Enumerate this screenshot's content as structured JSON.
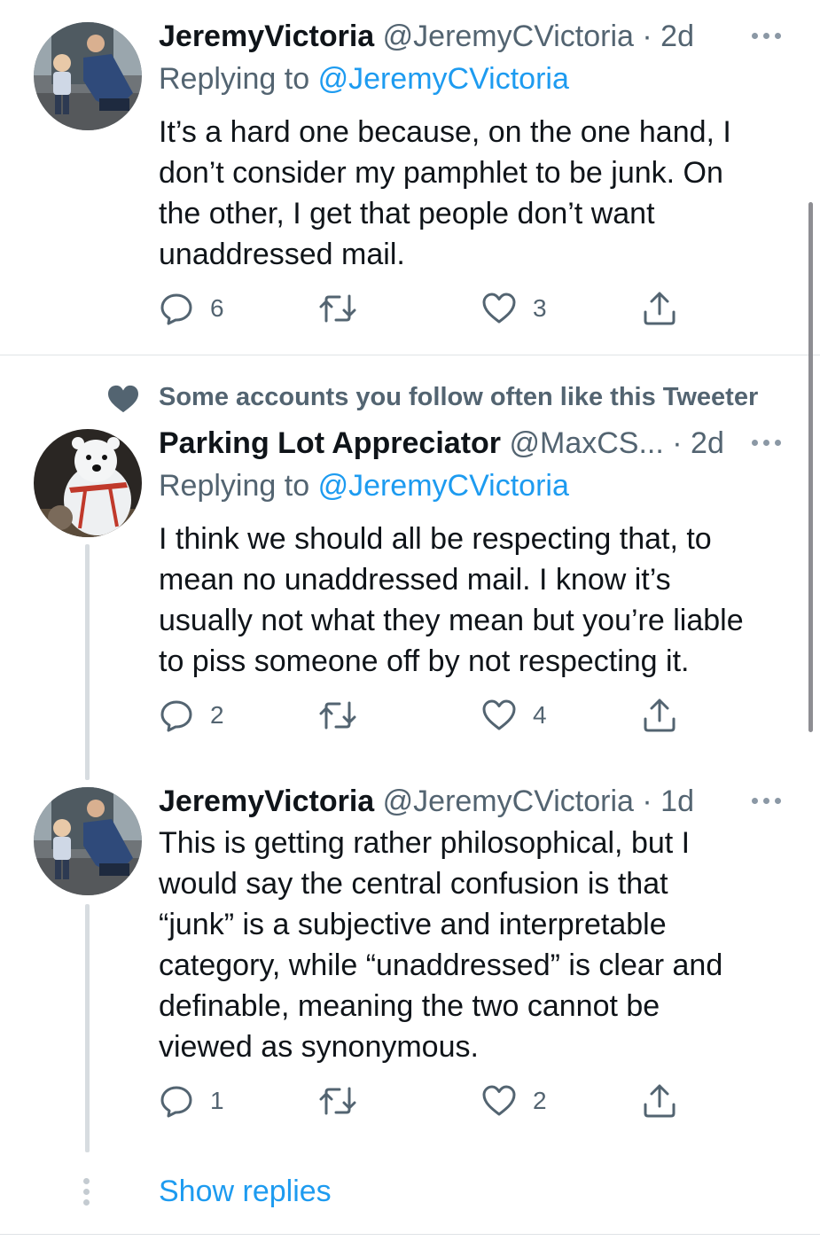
{
  "tweets": [
    {
      "name": "JeremyVictoria",
      "handle": "@JeremyCVictoria",
      "time": "· 2d",
      "replying_prefix": "Replying to",
      "replying_handle": "@JeremyCVictoria",
      "lines": [
        "It’s a hard one because, on the one hand, I",
        "don’t consider my pamphlet to be junk. On",
        "the other, I get that people don’t want",
        "unaddressed mail."
      ],
      "reply_count": "6",
      "like_count": "3"
    },
    {
      "social_context": "Some accounts you follow often like this Tweeter",
      "name": "Parking Lot Appreciator",
      "handle": "@MaxCS...",
      "time": "· 2d",
      "replying_prefix": "Replying to",
      "replying_handle": "@JeremyCVictoria",
      "lines": [
        "I think we should all be respecting that, to",
        "mean no unaddressed mail. I know it’s",
        "usually not what they mean but you’re liable",
        "to piss someone off by not respecting it."
      ],
      "reply_count": "2",
      "like_count": "4"
    },
    {
      "name": "JeremyVictoria",
      "handle": "@JeremyCVictoria",
      "time": "· 1d",
      "lines": [
        "This is getting rather philosophical, but I",
        "would say the central confusion is that",
        "“junk” is a subjective and interpretable",
        "category, while “unaddressed” is clear and",
        "definable, meaning the two cannot be",
        "viewed as synonymous."
      ],
      "reply_count": "1",
      "like_count": "2"
    }
  ],
  "show_replies_label": "Show replies",
  "icons": {
    "reply": "reply-icon",
    "retweet": "retweet-icon",
    "like": "heart-icon",
    "share": "share-icon",
    "more": "more-icon",
    "social": "heart-filled-icon"
  },
  "colors": {
    "link": "#1d9bf0",
    "meta": "#536471",
    "text": "#0f1419"
  }
}
